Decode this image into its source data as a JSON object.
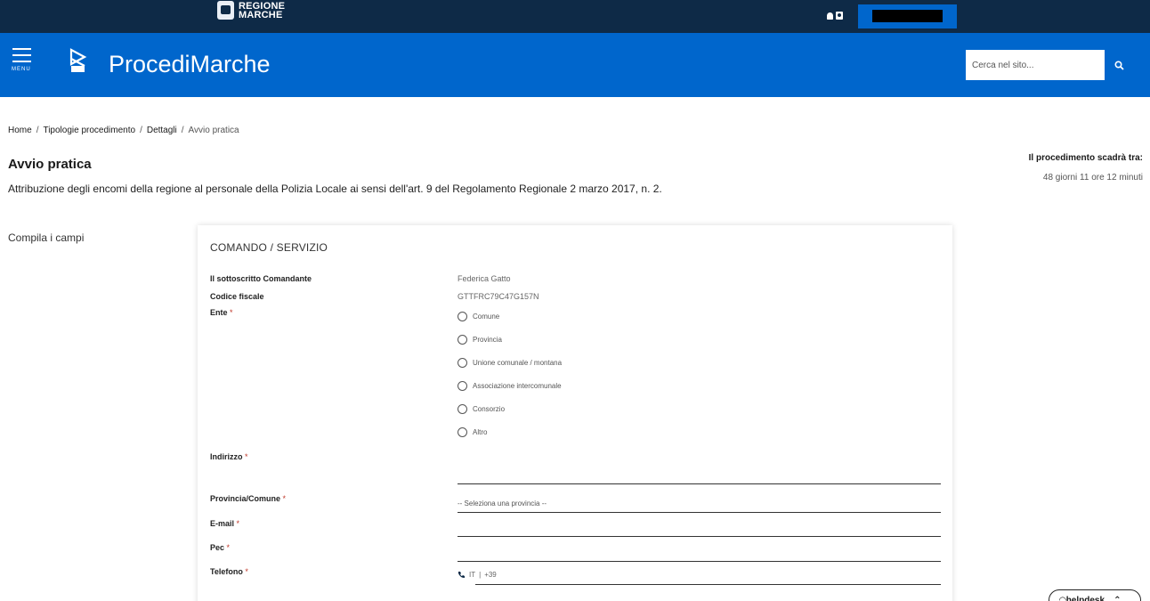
{
  "topbar": {
    "region_line1": "REGIONE",
    "region_line2": "MARCHE"
  },
  "header": {
    "menu_label": "MENU",
    "title": "ProcediMarche",
    "search_placeholder": "Cerca nel sito..."
  },
  "breadcrumb": {
    "items": [
      "Home",
      "Tipologie procedimento",
      "Dettagli"
    ],
    "current": "Avvio pratica"
  },
  "page": {
    "title": "Avvio pratica",
    "description": "Attribuzione degli encomi della regione al personale della Polizia Locale ai sensi dell'art. 9 del Regolamento Regionale 2 marzo 2017, n. 2.",
    "deadline_label": "Il procedimento scadrà tra:",
    "deadline_value": "48 giorni 11 ore 12 minuti",
    "left_label": "Compila i campi"
  },
  "form": {
    "section_title": "COMANDO / SERVIZIO",
    "sottoscritto_label": "Il sottoscritto Comandante",
    "sottoscritto_value": "Federica Gatto",
    "codice_fiscale_label": "Codice fiscale",
    "codice_fiscale_value": "GTTFRC79C47G157N",
    "ente_label": "Ente",
    "ente_options": [
      "Comune",
      "Provincia",
      "Unione comunale / montana",
      "Associazione intercomunale",
      "Consorzio",
      "Altro"
    ],
    "indirizzo_label": "Indirizzo",
    "provincia_label": "Provincia/Comune",
    "provincia_placeholder": "-- Seleziona una provincia --",
    "email_label": "E-mail",
    "pec_label": "Pec",
    "telefono_label": "Telefono",
    "phone_country": "IT",
    "phone_prefix": "+39",
    "required_mark": "*"
  },
  "helpdesk": {
    "label": "helpdesk"
  },
  "colors": {
    "topbar": "#0e2a47",
    "header": "#0066cc",
    "required": "#c0392b"
  }
}
